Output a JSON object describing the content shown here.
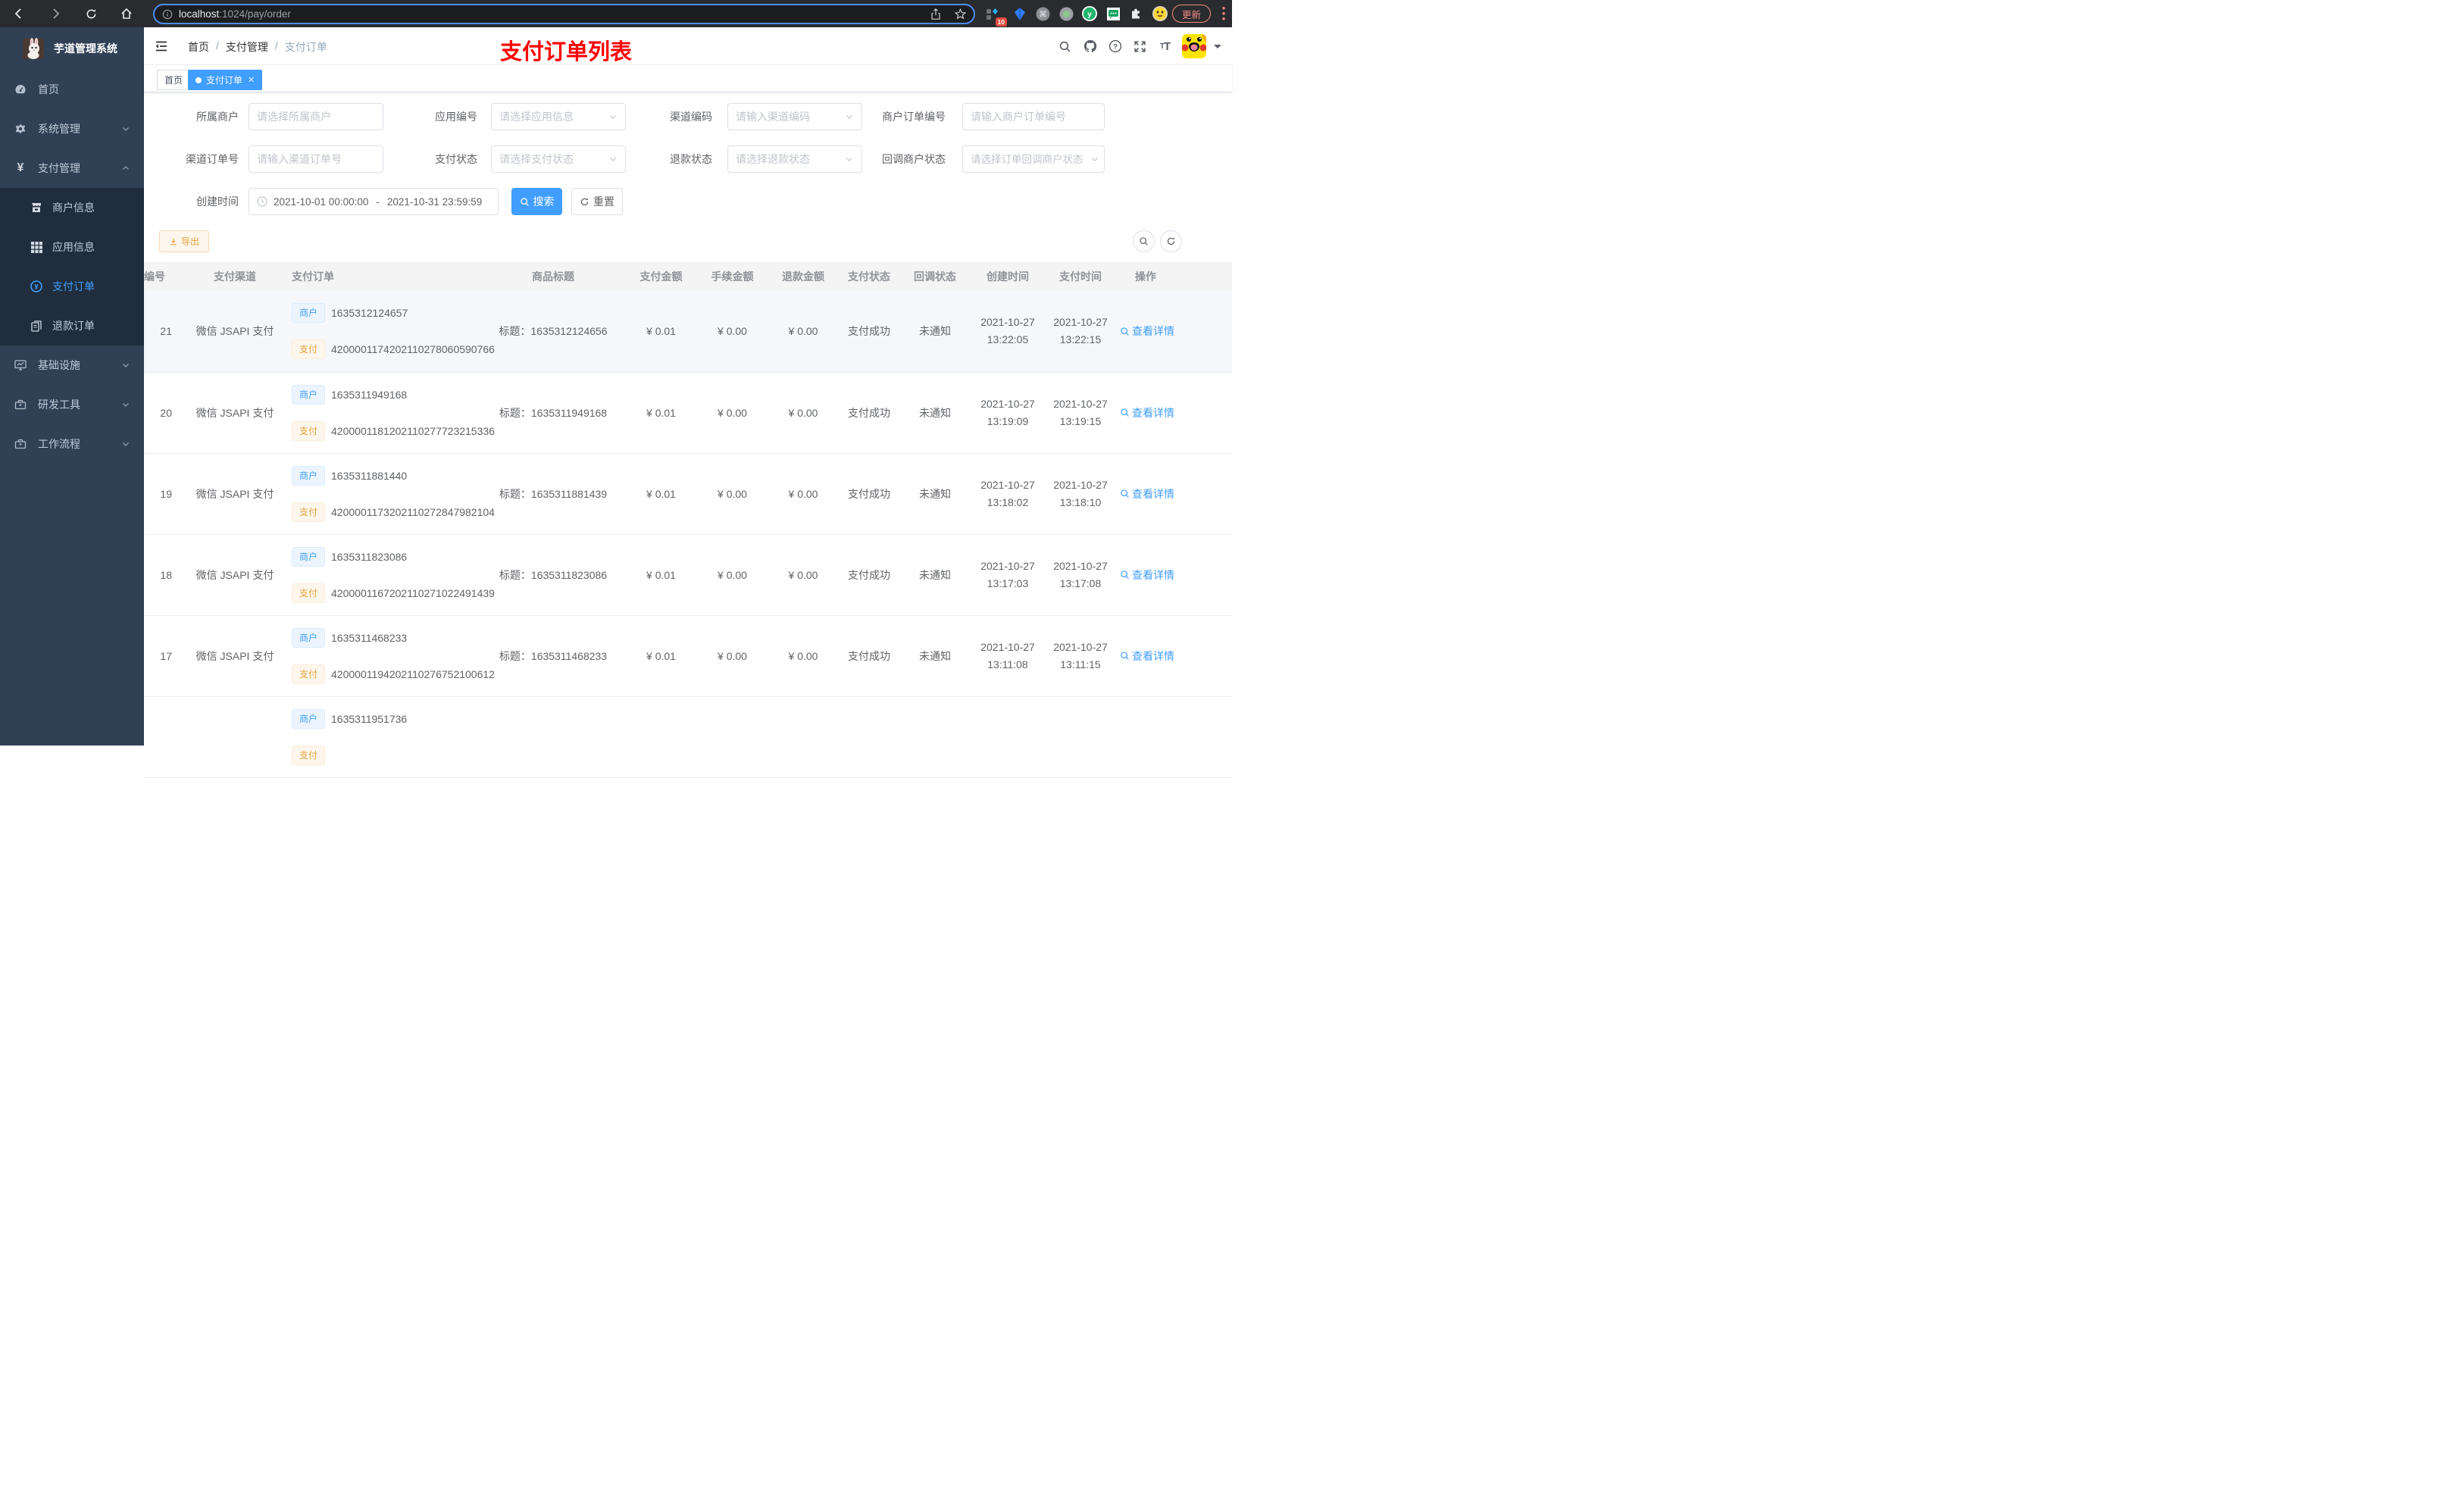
{
  "browser": {
    "url_host": "localhost",
    "url_rest": ":1024/pay/order",
    "ext_badge": "10",
    "update_label": "更新"
  },
  "sidebar": {
    "title": "芋道管理系统",
    "items": [
      {
        "label": "首页"
      },
      {
        "label": "系统管理"
      },
      {
        "label": "支付管理"
      },
      {
        "label": "基础设施"
      },
      {
        "label": "研发工具"
      },
      {
        "label": "工作流程"
      }
    ],
    "submenu": [
      {
        "label": "商户信息"
      },
      {
        "label": "应用信息"
      },
      {
        "label": "支付订单"
      },
      {
        "label": "退款订单"
      }
    ]
  },
  "header": {
    "breadcrumb": [
      "首页",
      "支付管理",
      "支付订单"
    ],
    "annotation": "支付订单列表",
    "tabs": [
      {
        "label": "首页"
      },
      {
        "label": "支付订单"
      }
    ]
  },
  "filters": {
    "row1": [
      {
        "label": "所属商户",
        "placeholder": "请选择所属商户"
      },
      {
        "label": "应用编号",
        "placeholder": "请选择应用信息"
      },
      {
        "label": "渠道编码",
        "placeholder": "请输入渠道编码"
      },
      {
        "label": "商户订单编号",
        "placeholder": "请输入商户订单编号"
      }
    ],
    "row2": [
      {
        "label": "渠道订单号",
        "placeholder": "请输入渠道订单号"
      },
      {
        "label": "支付状态",
        "placeholder": "请选择支付状态"
      },
      {
        "label": "退款状态",
        "placeholder": "请选择退款状态"
      },
      {
        "label": "回调商户状态",
        "placeholder": "请选择订单回调商户状态"
      }
    ],
    "create_time": {
      "label": "创建时间",
      "start": "2021-10-01 00:00:00",
      "sep": "-",
      "end": "2021-10-31 23:59:59"
    },
    "search_label": "搜索",
    "reset_label": "重置"
  },
  "toolbar": {
    "export_label": "导出"
  },
  "table": {
    "headers": [
      "编号",
      "支付渠道",
      "支付订单",
      "商品标题",
      "支付金额",
      "手续金额",
      "退款金额",
      "支付状态",
      "回调状态",
      "创建时间",
      "支付时间",
      "操作"
    ],
    "merchant_tag": "商户",
    "pay_tag": "支付",
    "title_prefix": "标题：",
    "detail_label": "查看详情",
    "rows": [
      {
        "id": "21",
        "channel": "微信 JSAPI 支付",
        "merchant_no": "1635312124657",
        "pay_no": "4200001174202110278060590766",
        "title": "1635312124656",
        "amount": "¥ 0.01",
        "fee": "¥ 0.00",
        "refund": "¥ 0.00",
        "status": "支付成功",
        "notify": "未通知",
        "create_date": "2021-10-27",
        "create_time": "13:22:05",
        "pay_date": "2021-10-27",
        "pay_time": "13:22:15"
      },
      {
        "id": "20",
        "channel": "微信 JSAPI 支付",
        "merchant_no": "1635311949168",
        "pay_no": "4200001181202110277723215336",
        "title": "1635311949168",
        "amount": "¥ 0.01",
        "fee": "¥ 0.00",
        "refund": "¥ 0.00",
        "status": "支付成功",
        "notify": "未通知",
        "create_date": "2021-10-27",
        "create_time": "13:19:09",
        "pay_date": "2021-10-27",
        "pay_time": "13:19:15"
      },
      {
        "id": "19",
        "channel": "微信 JSAPI 支付",
        "merchant_no": "1635311881440",
        "pay_no": "4200001173202110272847982104",
        "title": "1635311881439",
        "amount": "¥ 0.01",
        "fee": "¥ 0.00",
        "refund": "¥ 0.00",
        "status": "支付成功",
        "notify": "未通知",
        "create_date": "2021-10-27",
        "create_time": "13:18:02",
        "pay_date": "2021-10-27",
        "pay_time": "13:18:10"
      },
      {
        "id": "18",
        "channel": "微信 JSAPI 支付",
        "merchant_no": "1635311823086",
        "pay_no": "4200001167202110271022491439",
        "title": "1635311823086",
        "amount": "¥ 0.01",
        "fee": "¥ 0.00",
        "refund": "¥ 0.00",
        "status": "支付成功",
        "notify": "未通知",
        "create_date": "2021-10-27",
        "create_time": "13:17:03",
        "pay_date": "2021-10-27",
        "pay_time": "13:17:08"
      },
      {
        "id": "17",
        "channel": "微信 JSAPI 支付",
        "merchant_no": "1635311468233",
        "pay_no": "4200001194202110276752100612",
        "title": "1635311468233",
        "amount": "¥ 0.01",
        "fee": "¥ 0.00",
        "refund": "¥ 0.00",
        "status": "支付成功",
        "notify": "未通知",
        "create_date": "2021-10-27",
        "create_time": "13:11:08",
        "pay_date": "2021-10-27",
        "pay_time": "13:11:15"
      },
      {
        "id": "",
        "channel": "",
        "merchant_no": "1635311951736",
        "pay_no": "",
        "title": "",
        "amount": "",
        "fee": "",
        "refund": "",
        "status": "",
        "notify": "",
        "create_date": "",
        "create_time": "",
        "pay_date": "",
        "pay_time": ""
      }
    ]
  }
}
